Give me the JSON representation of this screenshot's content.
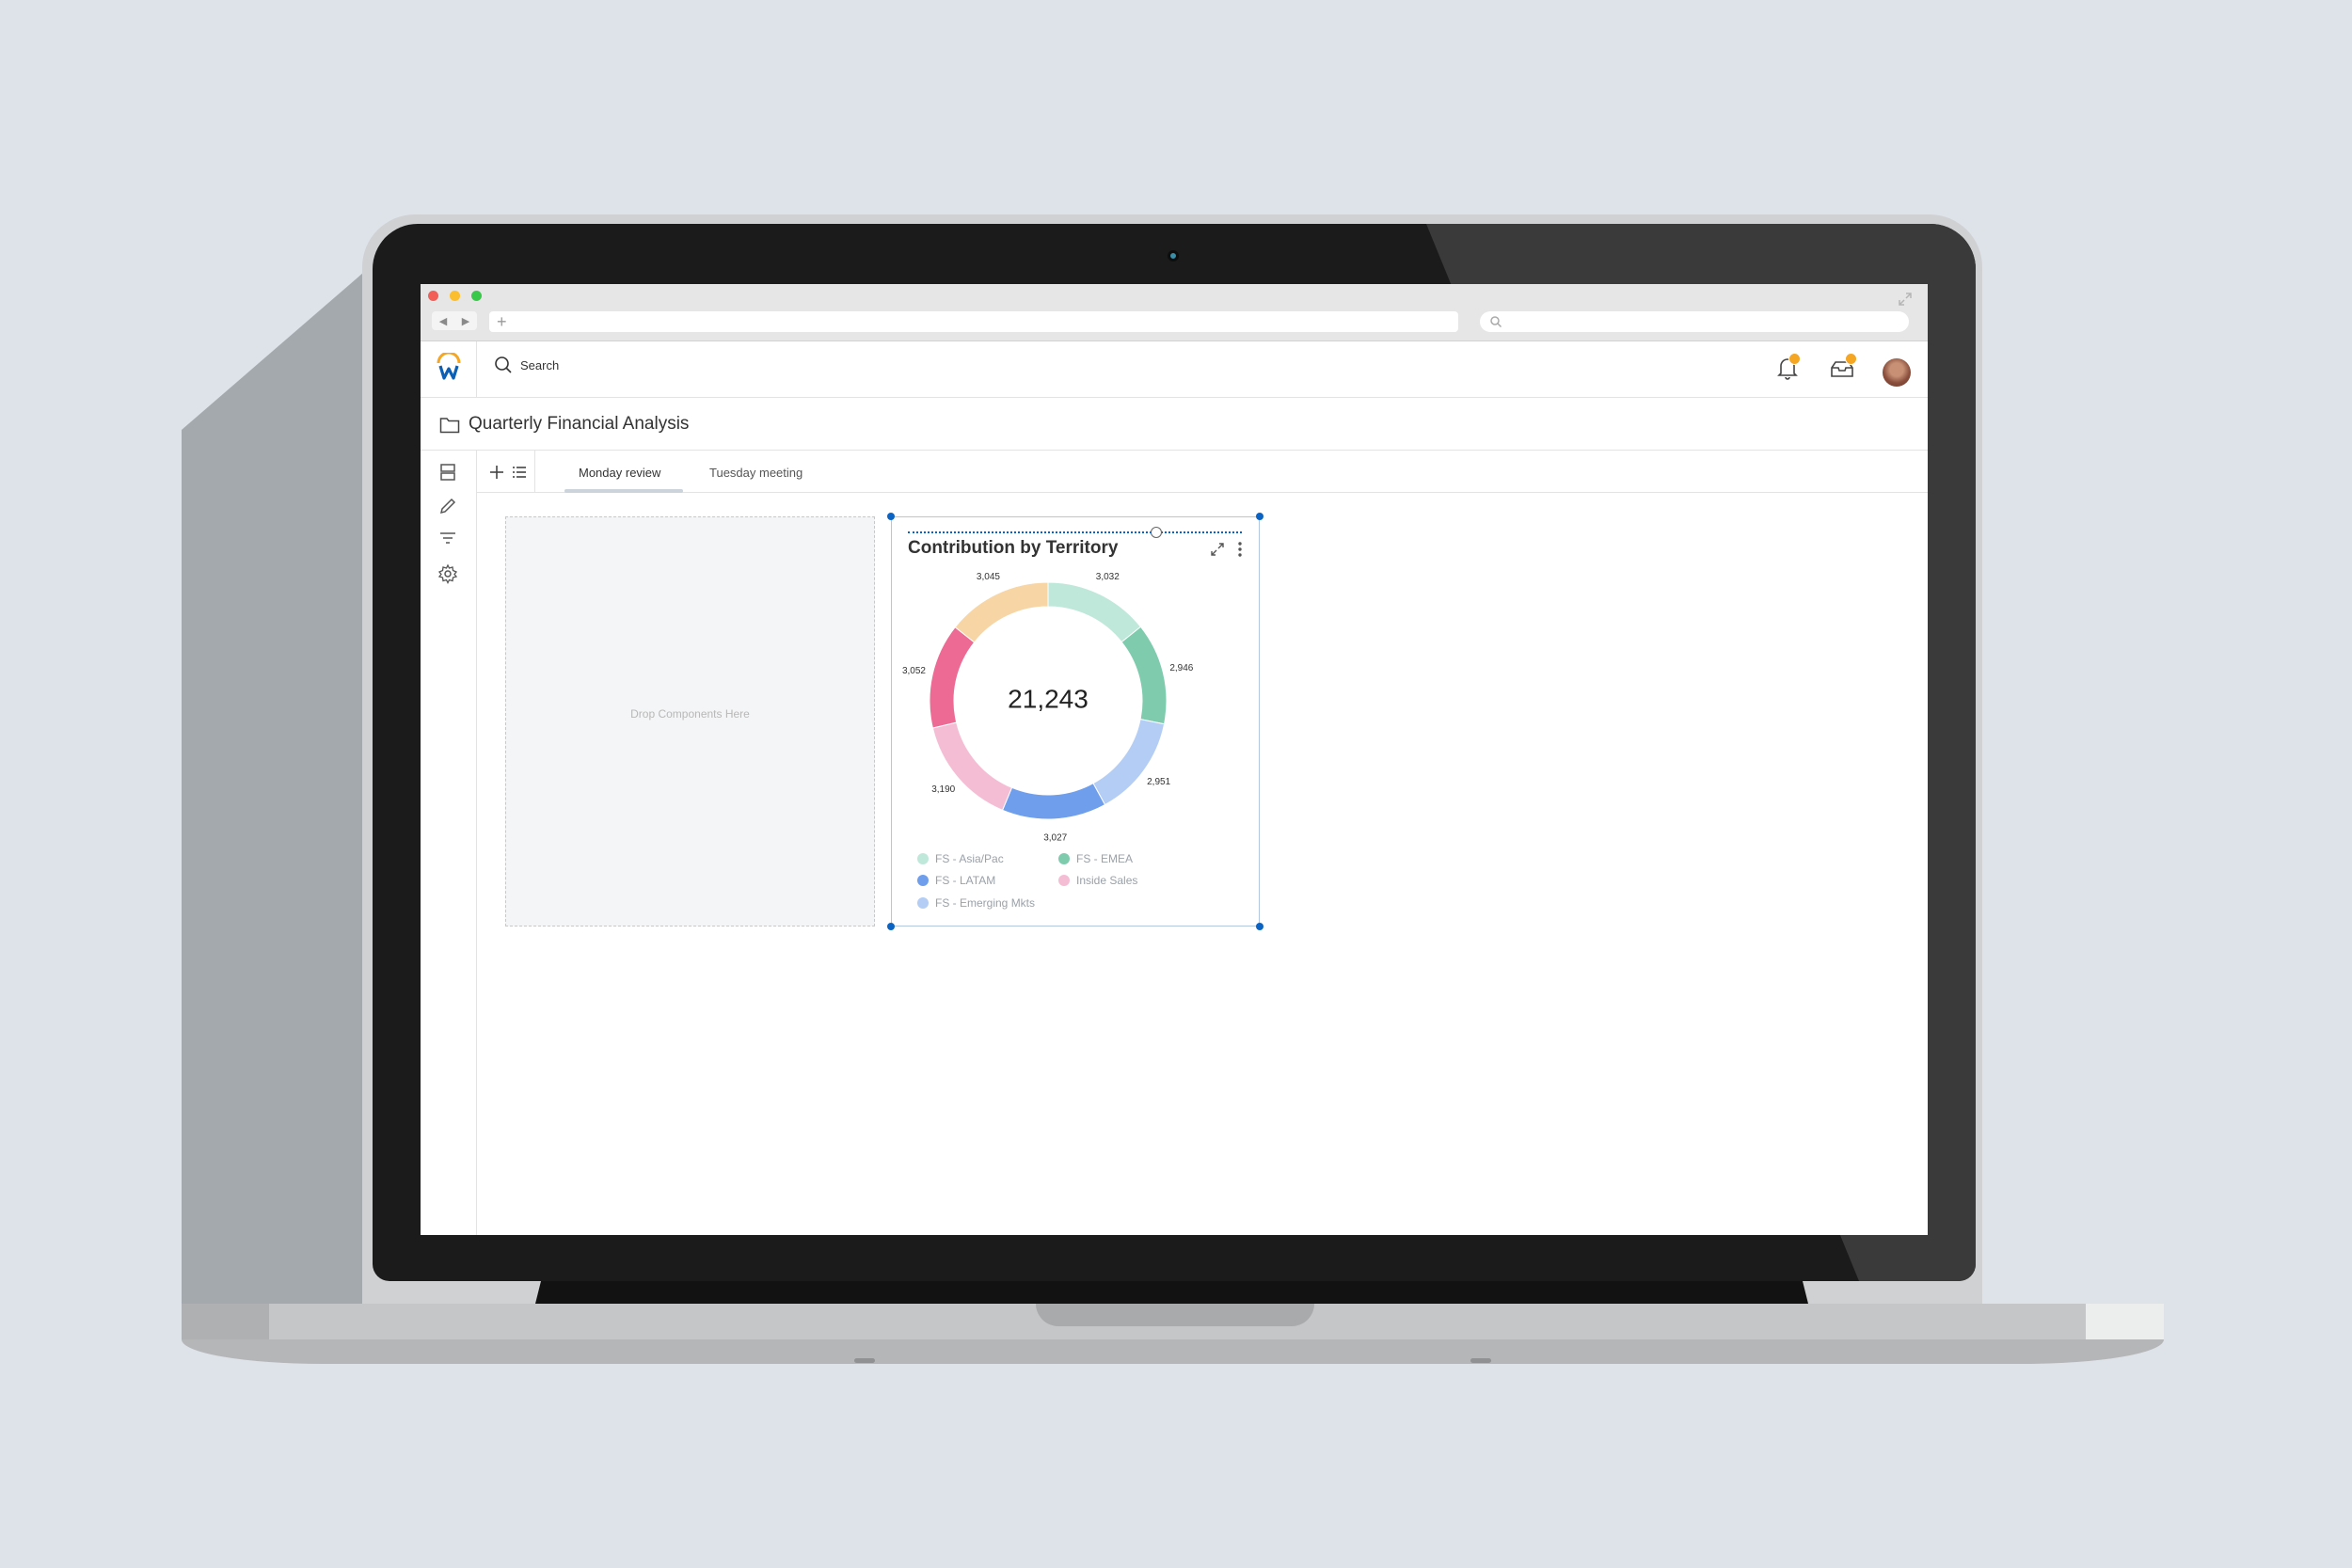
{
  "browser": {
    "url_placeholder": "+"
  },
  "header": {
    "search_label": "Search",
    "notification_count": "1",
    "inbox_count": "1"
  },
  "page": {
    "title": "Quarterly Financial Analysis"
  },
  "tabs": [
    {
      "label": "Monday review",
      "active": true
    },
    {
      "label": "Tuesday meeting",
      "active": false
    }
  ],
  "dropzone": {
    "label": "Drop Components Here"
  },
  "widget": {
    "title": "Contribution by Territory",
    "total_label": "21,243"
  },
  "colors": {
    "accent": "#0b63c4",
    "badge": "#f5a623"
  },
  "chart_data": {
    "type": "pie",
    "title": "Contribution by Territory",
    "center_label": "21,243",
    "series": [
      {
        "name": "FS - Asia/Pac",
        "value": 3032,
        "value_label": "3,032",
        "color": "#bfe8da"
      },
      {
        "name": "FS - EMEA",
        "value": 2946,
        "value_label": "2,946",
        "color": "#7fcbad"
      },
      {
        "name": "FS - Emerging Mkts",
        "value": 2951,
        "value_label": "2,951",
        "color": "#b3cdf5"
      },
      {
        "name": "FS - LATAM",
        "value": 3027,
        "value_label": "3,027",
        "color": "#6e9eec"
      },
      {
        "name": "Inside Sales",
        "value": 3190,
        "value_label": "3,190",
        "color": "#f5bdd3"
      },
      {
        "name": "",
        "value": 3052,
        "value_label": "3,052",
        "color": "#ec6a94"
      },
      {
        "name": "",
        "value": 3045,
        "value_label": "3,045",
        "color": "#f7d5a5"
      }
    ],
    "legend_items": [
      "FS - Asia/Pac",
      "FS - EMEA",
      "FS - LATAM",
      "Inside Sales",
      "FS - Emerging Mkts"
    ],
    "legend_position": "bottom"
  }
}
